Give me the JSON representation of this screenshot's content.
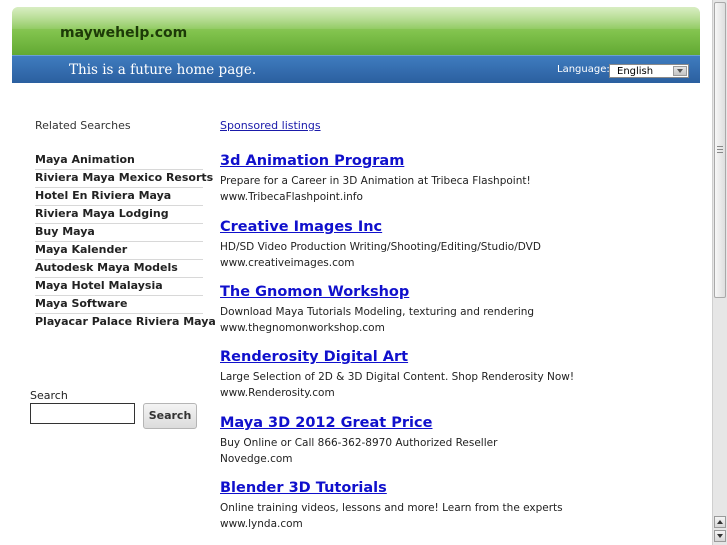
{
  "header": {
    "site_title": "maywehelp.com",
    "tagline": "This is a future home page.",
    "language_label": "Language:",
    "language_value": "English"
  },
  "related": {
    "title": "Related Searches",
    "items": [
      "Maya Animation",
      "Riviera Maya Mexico Resorts",
      "Hotel En Riviera Maya",
      "Riviera Maya Lodging",
      "Buy Maya",
      "Maya Kalender",
      "Autodesk Maya Models",
      "Maya Hotel Malaysia",
      "Maya Software",
      "Playacar Palace Riviera Maya"
    ]
  },
  "search": {
    "label": "Search",
    "button": "Search",
    "value": ""
  },
  "sponsored": {
    "label": "Sponsored listings",
    "ads": [
      {
        "title": "3d Animation Program",
        "desc": "Prepare for a Career in 3D Animation at Tribeca Flashpoint!",
        "url": "www.TribecaFlashpoint.info"
      },
      {
        "title": "Creative Images Inc",
        "desc": "HD/SD Video Production Writing/Shooting/Editing/Studio/DVD",
        "url": "www.creativeimages.com"
      },
      {
        "title": "The Gnomon Workshop",
        "desc": "Download Maya Tutorials Modeling, texturing and rendering",
        "url": "www.thegnomonworkshop.com"
      },
      {
        "title": "Renderosity Digital Art",
        "desc": "Large Selection of 2D & 3D Digital Content. Shop Renderosity Now!",
        "url": "www.Renderosity.com"
      },
      {
        "title": "Maya 3D 2012 Great Price",
        "desc": "Buy Online or Call 866-362-8970 Authorized Reseller",
        "url": "Novedge.com"
      },
      {
        "title": "Blender 3D Tutorials",
        "desc": "Online training videos, lessons and more! Learn from the experts",
        "url": "www.lynda.com"
      }
    ]
  }
}
